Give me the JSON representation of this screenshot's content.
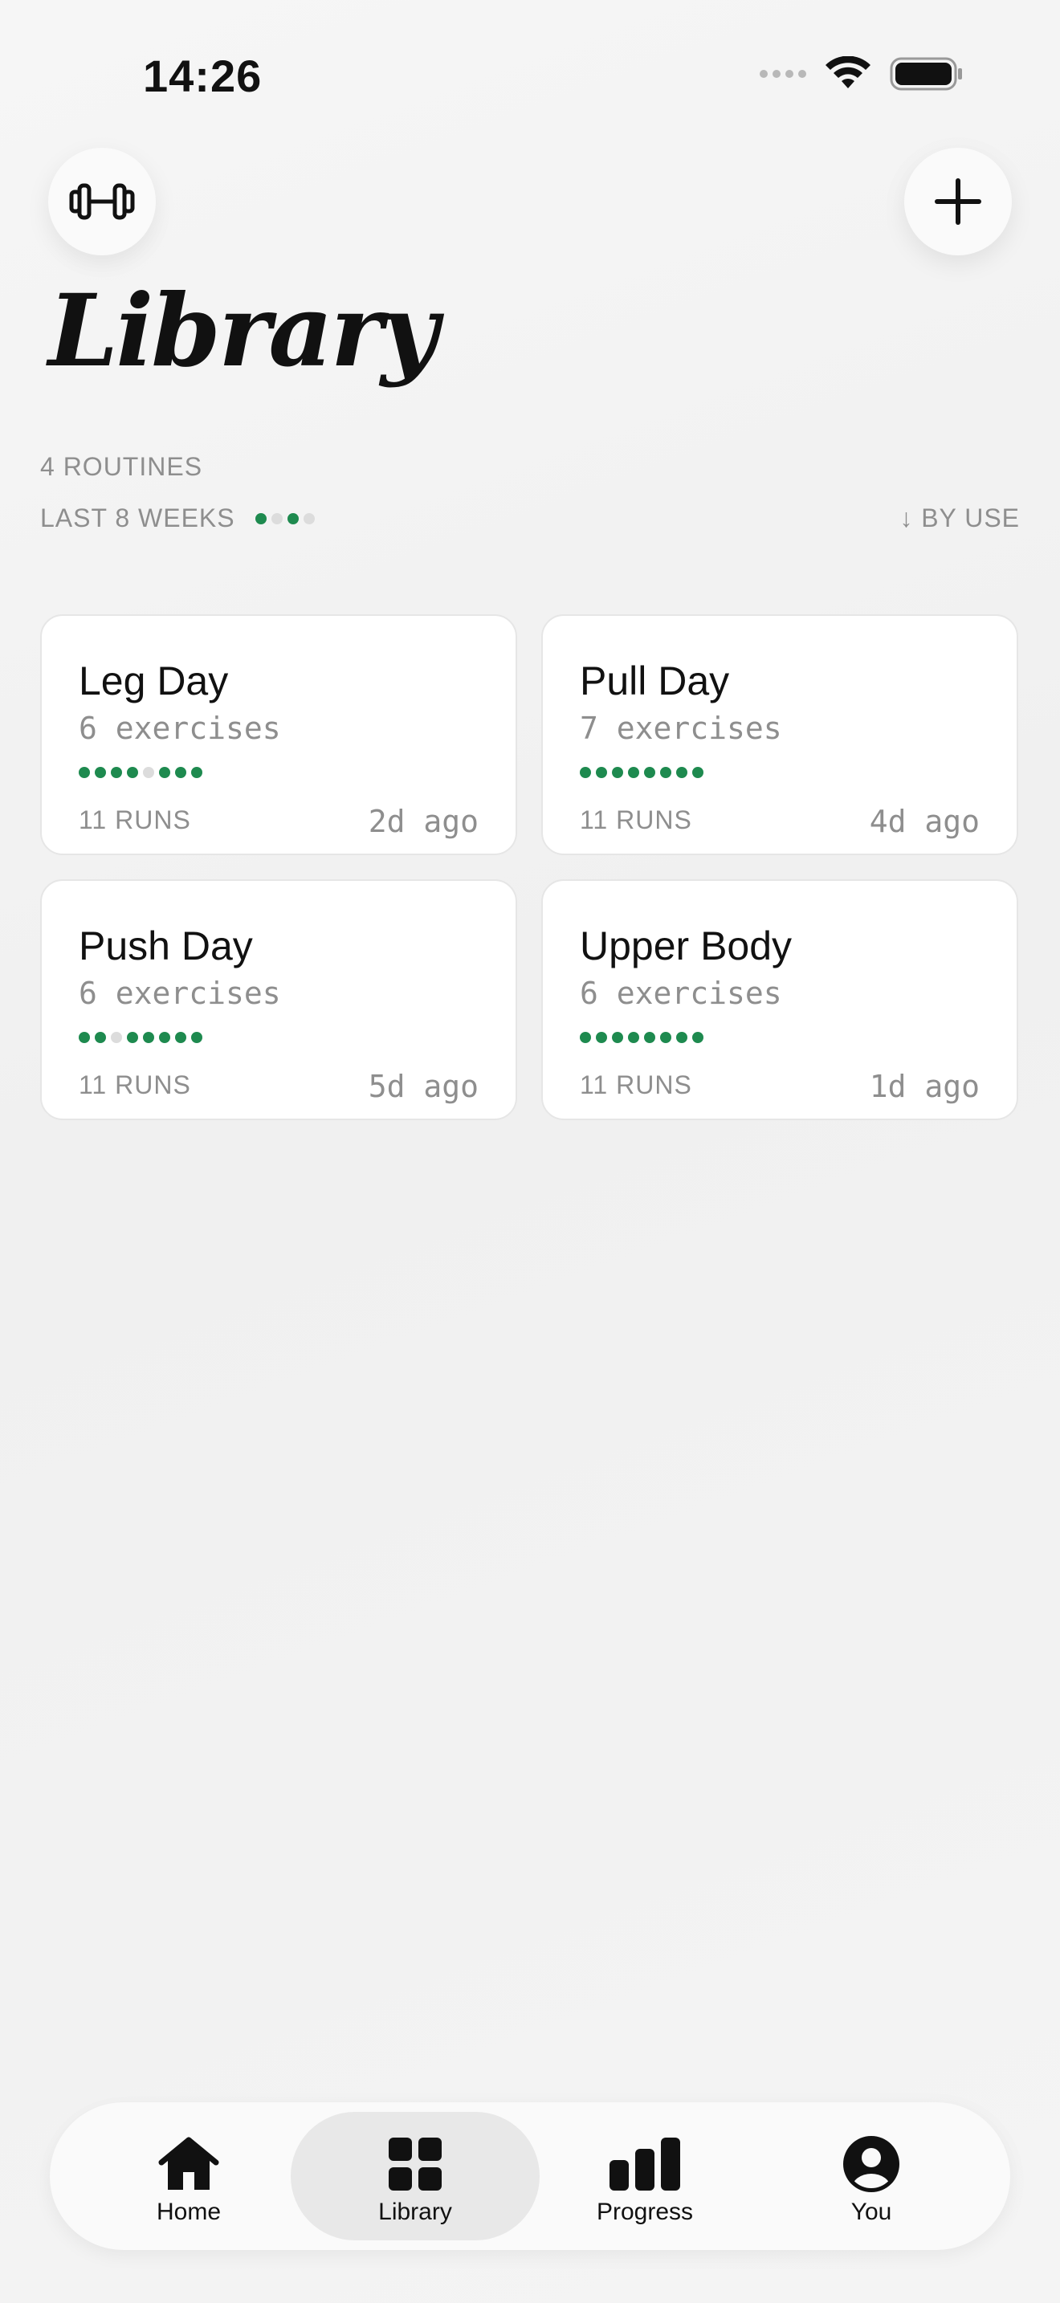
{
  "status_bar": {
    "time": "14:26",
    "icons": [
      "signal-dots-icon",
      "wifi-icon",
      "battery-icon"
    ]
  },
  "header": {
    "left_button_icon": "dumbbell-icon",
    "right_button_icon": "plus-icon",
    "title": "Library"
  },
  "summary": {
    "routines_label": "4 ROUTINES",
    "weeks_label": "LAST 8 WEEKS",
    "weeks_activity": [
      true,
      false,
      true,
      false
    ],
    "sort_label": "↓ BY USE"
  },
  "colors": {
    "accent_green": "#1e8a4f",
    "inactive_dot": "#dcdcdc"
  },
  "routines": [
    {
      "name": "Leg Day",
      "exercises": "6 exercises",
      "activity": [
        true,
        true,
        true,
        true,
        false,
        true,
        true,
        true
      ],
      "runs": "11 RUNS",
      "last": "2d ago"
    },
    {
      "name": "Pull Day",
      "exercises": "7 exercises",
      "activity": [
        true,
        true,
        true,
        true,
        true,
        true,
        true,
        true
      ],
      "runs": "11 RUNS",
      "last": "4d ago"
    },
    {
      "name": "Push Day",
      "exercises": "6 exercises",
      "activity": [
        true,
        true,
        false,
        true,
        true,
        true,
        true,
        true
      ],
      "runs": "11 RUNS",
      "last": "5d ago"
    },
    {
      "name": "Upper Body",
      "exercises": "6 exercises",
      "activity": [
        true,
        true,
        true,
        true,
        true,
        true,
        true,
        true
      ],
      "runs": "11 RUNS",
      "last": "1d ago"
    }
  ],
  "tabbar": {
    "tabs": [
      {
        "label": "Home",
        "icon": "home-icon",
        "active": false
      },
      {
        "label": "Library",
        "icon": "grid-icon",
        "active": true
      },
      {
        "label": "Progress",
        "icon": "bar-chart-icon",
        "active": false
      },
      {
        "label": "You",
        "icon": "person-icon",
        "active": false
      }
    ]
  }
}
